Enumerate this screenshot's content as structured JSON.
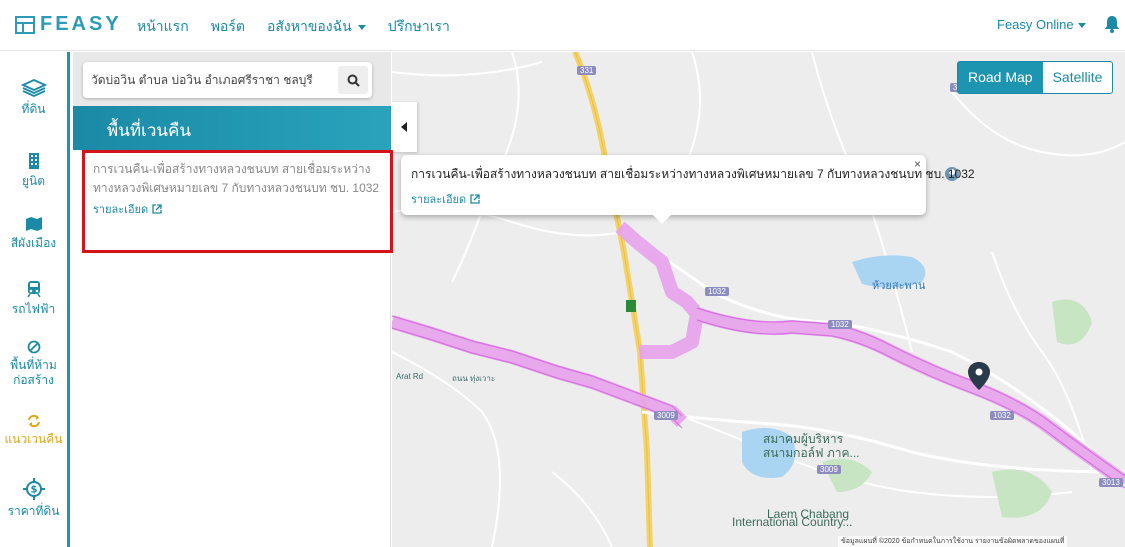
{
  "brand": {
    "name": "FEASY",
    "accent": "#1a8aa6"
  },
  "nav": {
    "items": [
      {
        "label": "หน้าแรก"
      },
      {
        "label": "พอร์ต"
      },
      {
        "label": "อสังหาของฉัน"
      },
      {
        "label": "ปรึกษาเรา"
      }
    ],
    "user_label": "Feasy Online"
  },
  "rail": {
    "items": [
      {
        "label": "ที่ดิน",
        "icon": "layers-icon"
      },
      {
        "label": "ยูนิต",
        "icon": "building-icon"
      },
      {
        "label": "สีผังเมือง",
        "icon": "map-icon"
      },
      {
        "label": "รถไฟฟ้า",
        "icon": "train-icon"
      },
      {
        "label": "พื้นที่ห้ามก่อสร้าง",
        "icon": "ban-icon"
      },
      {
        "label": "แนวเวนคืน",
        "icon": "refresh-icon"
      },
      {
        "label": "ราคาที่ดิน",
        "icon": "dollar-icon"
      }
    ],
    "active_color": "#e0a51c"
  },
  "search": {
    "value": "วัดบ่อวิน ตำบล บ่อวิน อำเภอศรีราชา ชลบุรี"
  },
  "panel": {
    "title": "พื้นที่เวนคืน",
    "result": {
      "text": "การเวนคืน-เพื่อสร้างทางหลวงชนบท สายเชื่อมระหว่างทางหลวงพิเศษหมายเลข 7 กับทางหลวงชนบท ชบ. 1032",
      "link_label": "รายละเอียด"
    }
  },
  "popup": {
    "text": "การเวนคืน-เพื่อสร้างทางหลวงชนบท สายเชื่อมระหว่างทางหลวงพิเศษหมายเลข 7 กับทางหลวงชนบท ชบ. 1032",
    "link_label": "รายละเอียด",
    "close": "×"
  },
  "map": {
    "toggle": {
      "road": "Road Map",
      "satellite": "Satellite"
    },
    "labels": {
      "golf": "สมาคมผู้บริหาร",
      "golf2": "สนามกอล์ฟ ภาค...",
      "laem1": "Laem Chabang",
      "laem2": "International Country...",
      "lake": "ห้วยสะพาน",
      "road1": "Arat Rd",
      "road2": "ถนน ทุ่งเวาะ"
    },
    "badges": [
      "331",
      "331",
      "1032",
      "1032",
      "3009",
      "3009",
      "1032",
      "3013"
    ],
    "attribution": "ข้อมูลแผนที่ ©2020   ข้อกำหนดในการใช้งาน   รายงานข้อผิดพลาดของแผนที่"
  }
}
